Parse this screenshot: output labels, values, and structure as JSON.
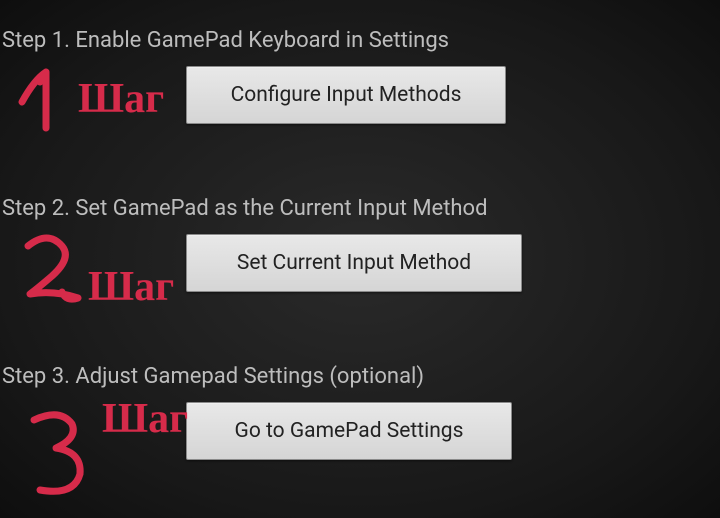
{
  "steps": [
    {
      "label": "Step 1. Enable GamePad Keyboard in Settings",
      "button": "Configure Input Methods",
      "annotation_number": "1",
      "annotation_word": "Шаг"
    },
    {
      "label": "Step 2. Set GamePad as the Current Input Method",
      "button": "Set Current Input Method",
      "annotation_number": "2",
      "annotation_word": "Шаг"
    },
    {
      "label": "Step 3. Adjust Gamepad Settings (optional)",
      "button": "Go to GamePad Settings",
      "annotation_number": "3",
      "annotation_word": "Шаг"
    }
  ],
  "annotation_color": "#d62b4a"
}
